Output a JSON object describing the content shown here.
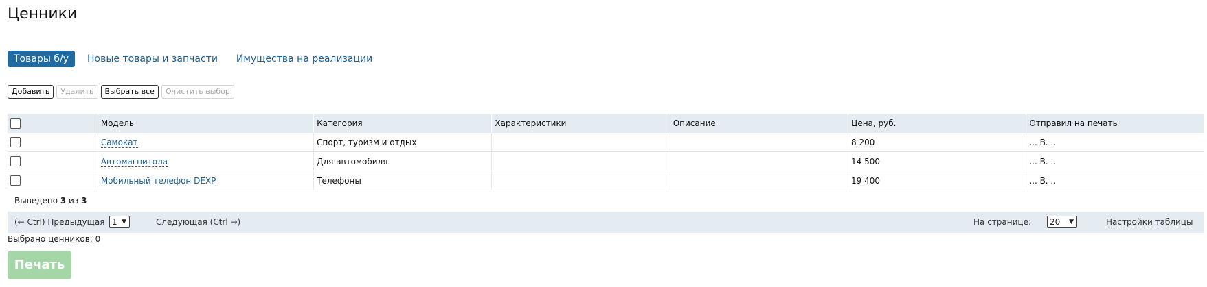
{
  "page": {
    "title": "Ценники"
  },
  "tabs": [
    {
      "label": "Товары б/у",
      "active": true
    },
    {
      "label": "Новые товары и запчасти",
      "active": false
    },
    {
      "label": "Имущества на реализации",
      "active": false
    }
  ],
  "toolbar": {
    "add_label": "Добавить",
    "delete_label": "Удалить",
    "select_all_label": "Выбрать все",
    "clear_selection_label": "Очистить выбор"
  },
  "table": {
    "columns": [
      "Модель",
      "Категория",
      "Характеристики",
      "Описание",
      "Цена, руб.",
      "Отправил на печать"
    ],
    "rows": [
      {
        "model": "Самокат",
        "category": "Спорт, туризм и отдых",
        "specs": "",
        "description": "",
        "price": "8 200",
        "sent_by": "... В. .."
      },
      {
        "model": "Автомагнитола",
        "category": "Для автомобиля",
        "specs": "",
        "description": "",
        "price": "14 500",
        "sent_by": "... В. .."
      },
      {
        "model": "Мобильный телефон DEXP",
        "category": "Телефоны",
        "specs": "",
        "description": "",
        "price": "19 400",
        "sent_by": "... В. .."
      }
    ]
  },
  "summary": {
    "prefix": "Выведено",
    "shown": "3",
    "of": "из",
    "total": "3"
  },
  "pager": {
    "prev_label": "(← Ctrl) Предыдущая",
    "current_page": "1",
    "next_label": "Следующая (Ctrl →)",
    "per_page_label": "На странице:",
    "per_page_value": "20",
    "settings_label": "Настройки таблицы"
  },
  "selection": {
    "selected_text": "Выбрано ценников: 0"
  },
  "print": {
    "label": "Печать"
  },
  "colors": {
    "active_tab_bg": "#1f6aa1",
    "link": "#1d5f96",
    "header_bg": "#e4ebf1",
    "print_button_bg": "#a5d6a7"
  }
}
